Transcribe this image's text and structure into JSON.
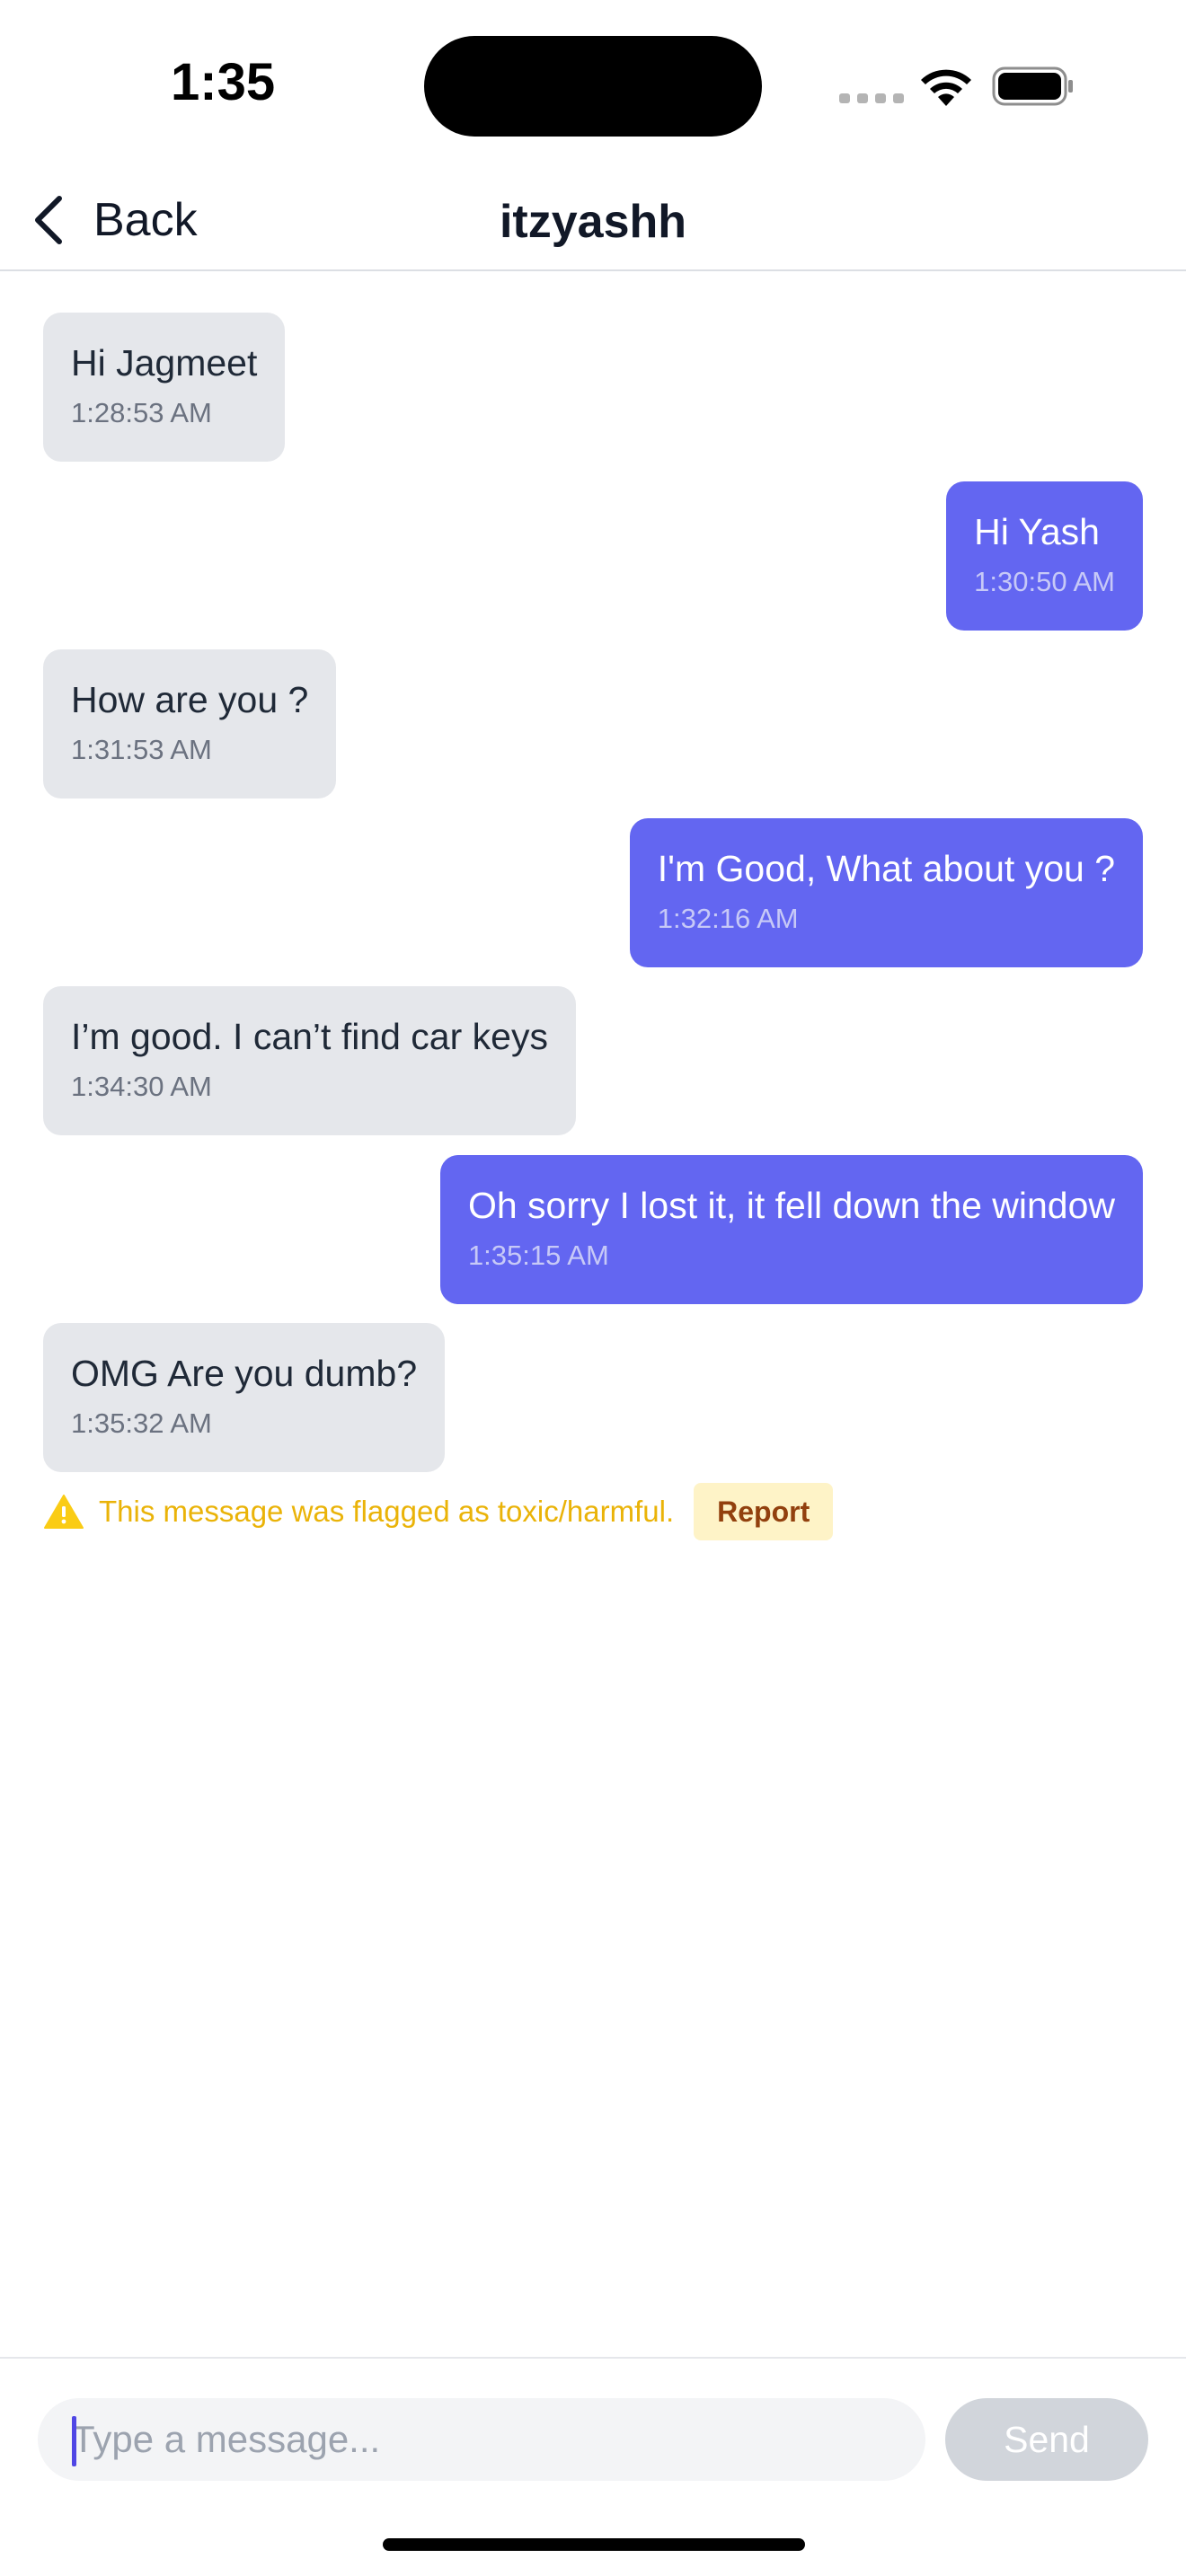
{
  "status_bar": {
    "time": "1:35",
    "icons": [
      "cellular-signal-icon",
      "wifi-icon",
      "battery-icon"
    ]
  },
  "header": {
    "back_label": "Back",
    "title": "itzyashh"
  },
  "messages": [
    {
      "direction": "incoming",
      "text": "Hi Jagmeet",
      "time": "1:28:53 AM"
    },
    {
      "direction": "outgoing",
      "text": "Hi Yash",
      "time": "1:30:50 AM"
    },
    {
      "direction": "incoming",
      "text": "How are you ?",
      "time": "1:31:53 AM"
    },
    {
      "direction": "outgoing",
      "text": "I'm Good, What about you ?",
      "time": "1:32:16 AM"
    },
    {
      "direction": "incoming",
      "text": "I’m good. I can’t find car keys",
      "time": "1:34:30 AM"
    },
    {
      "direction": "outgoing",
      "text": "Oh sorry I lost it, it fell down the window",
      "time": "1:35:15 AM"
    },
    {
      "direction": "incoming",
      "text": "OMG Are you dumb?",
      "time": "1:35:32 AM"
    }
  ],
  "flag": {
    "text": "This message was flagged as toxic/harmful.",
    "report_label": "Report"
  },
  "composer": {
    "placeholder": "Type a message...",
    "value": "",
    "send_label": "Send"
  },
  "colors": {
    "outgoing_bubble": "#6366f1",
    "incoming_bubble": "#e5e7eb",
    "warning": "#eab308",
    "report_bg": "#fef3c7",
    "send_disabled": "#d1d5db"
  }
}
